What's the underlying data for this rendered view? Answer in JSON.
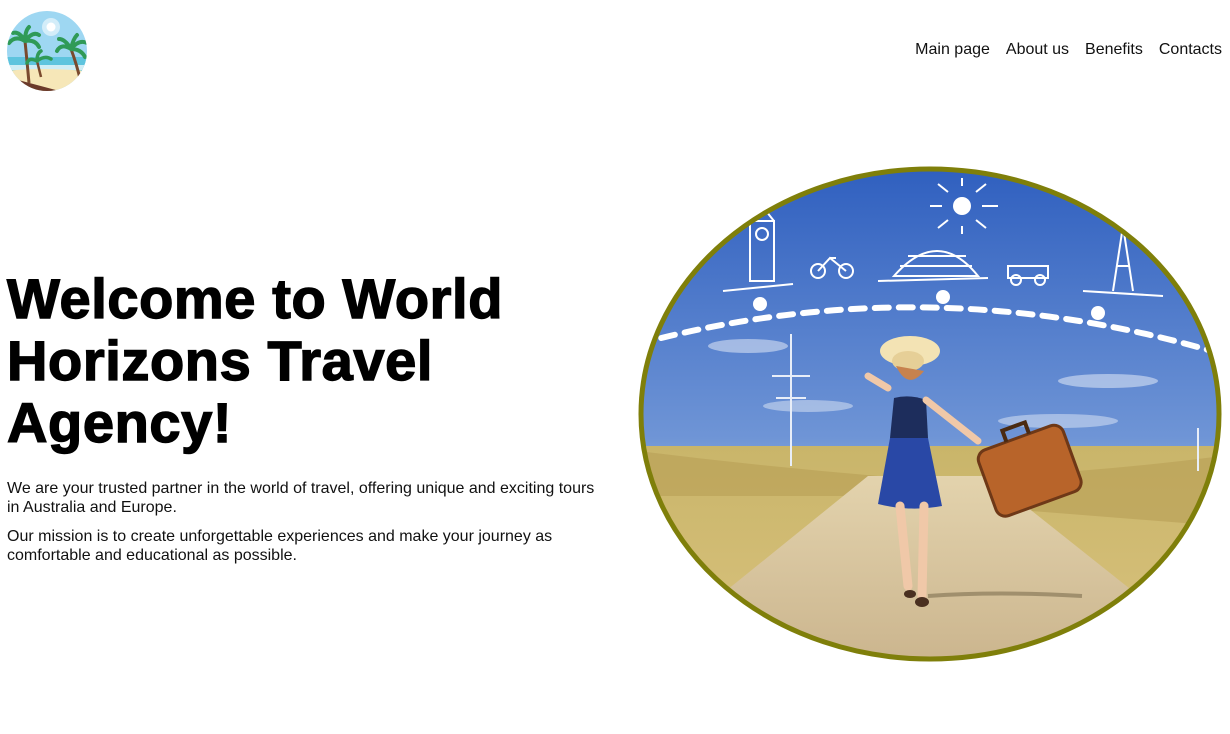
{
  "brand": {
    "logo_icon": "tropical-beach-logo-icon",
    "colors": {
      "sky": "#8fd1f0",
      "sea": "#5ec4de",
      "sand": "#f6e7b8",
      "palm": "#2f9a57",
      "trunk": "#6b3a2a"
    }
  },
  "nav": {
    "items": [
      {
        "label": "Main page"
      },
      {
        "label": "About us"
      },
      {
        "label": "Benefits"
      },
      {
        "label": "Contacts"
      }
    ]
  },
  "hero": {
    "title": "Welcome to World Horizons Travel Agency!",
    "paragraphs": [
      "We are your trusted partner in the world of travel, offering unique and exciting tours in Australia and Europe.",
      "Our mission is to create unforgettable experiences and make your journey as comfortable and educational as possible."
    ],
    "image": {
      "icon": "traveler-with-suitcase-image",
      "border_color": "#7f7f0a"
    }
  }
}
